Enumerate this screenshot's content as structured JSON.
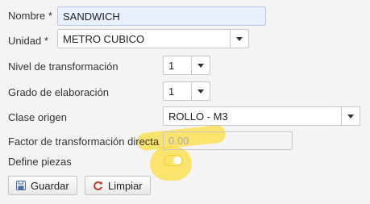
{
  "form": {
    "nombre": {
      "label": "Nombre",
      "required_mark": "*",
      "value": "SANDWICH"
    },
    "unidad": {
      "label": "Unidad",
      "required_mark": "*",
      "value": "METRO CUBICO"
    },
    "nivel_transformacion": {
      "label": "Nivel de transformación",
      "value": "1"
    },
    "grado_elaboracion": {
      "label": "Grado de elaboración",
      "value": "1"
    },
    "clase_origen": {
      "label": "Clase origen",
      "value": "ROLLO - M3"
    },
    "factor_transformacion": {
      "label": "Factor de transformación directa",
      "placeholder": "0.00"
    },
    "define_piezas": {
      "label": "Define piezas",
      "checked": true
    }
  },
  "buttons": {
    "guardar": "Guardar",
    "limpiar": "Limpiar"
  },
  "colors": {
    "highlight": "#ffd700",
    "save_icon": "#4a6fa5",
    "reset_icon": "#c0392b"
  }
}
